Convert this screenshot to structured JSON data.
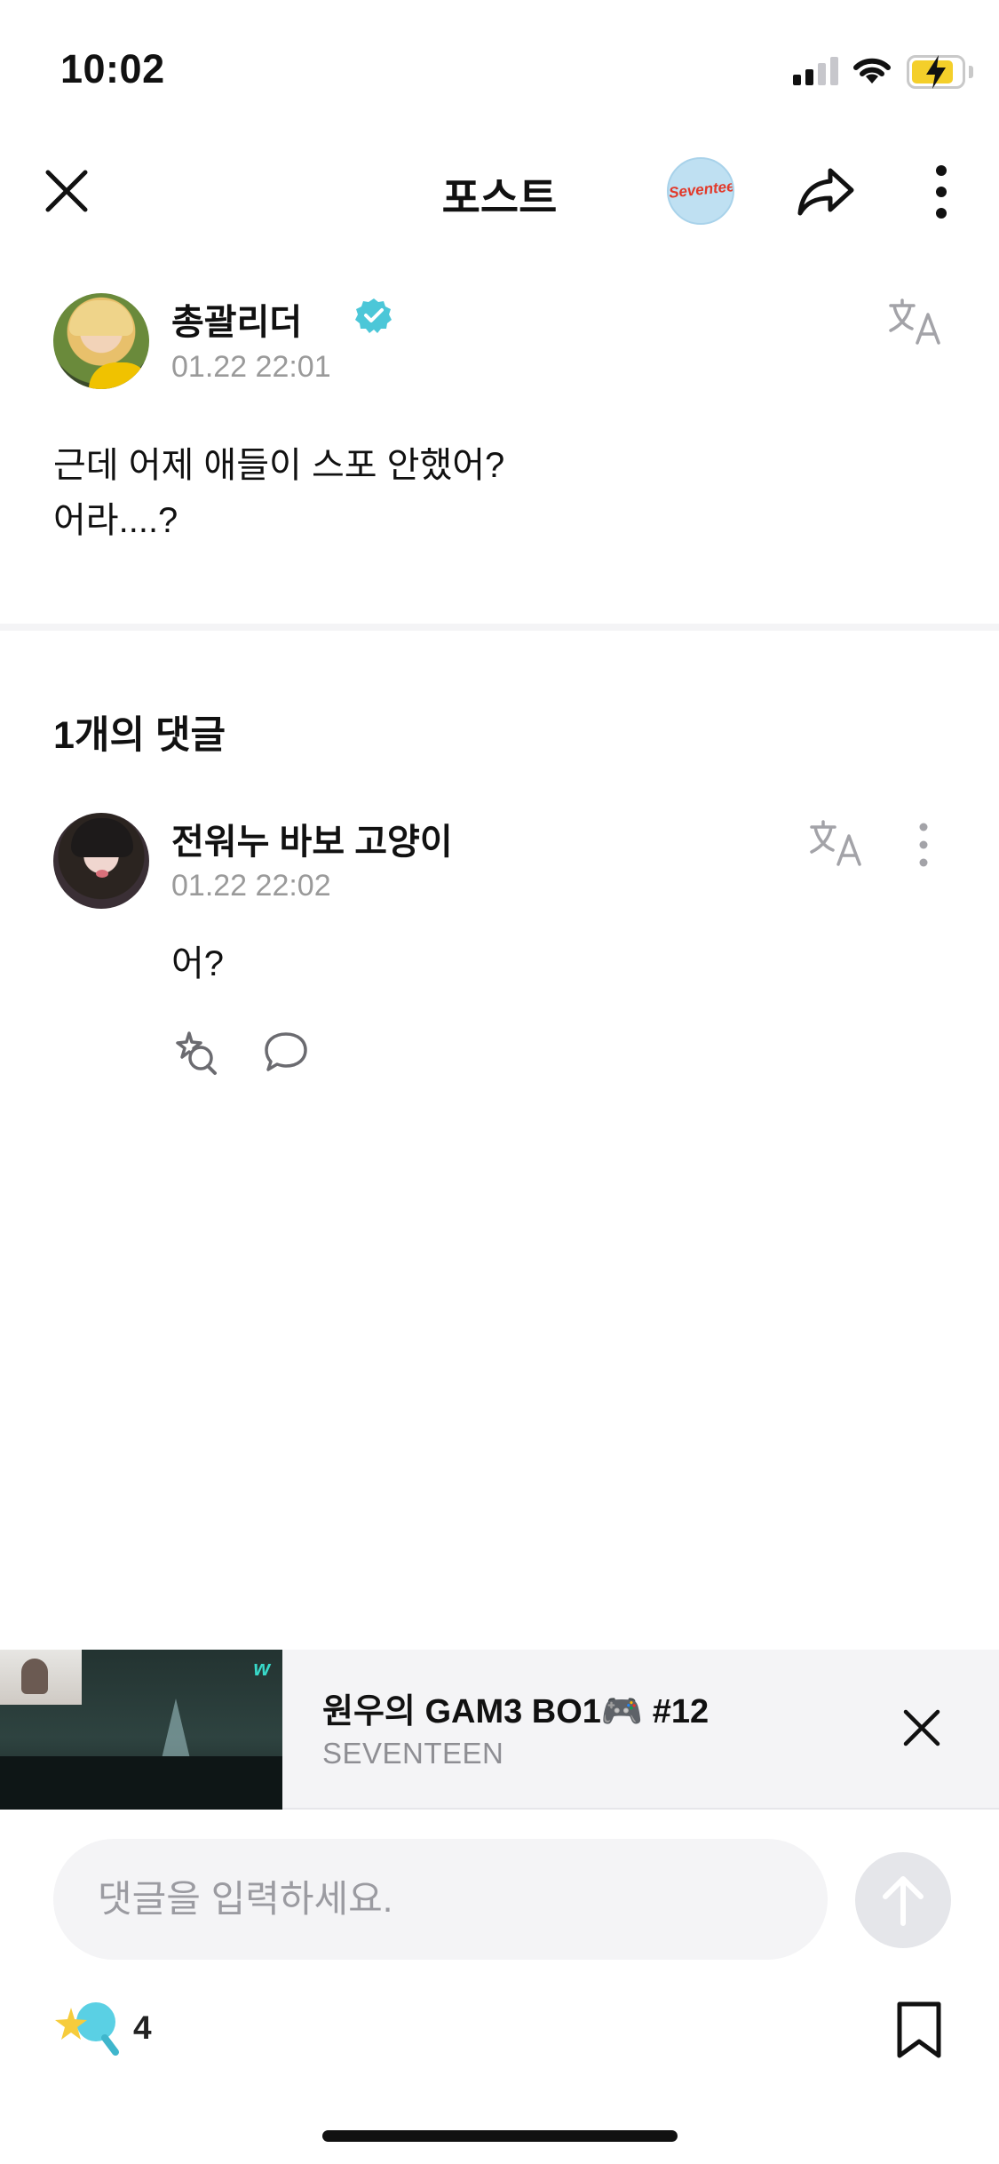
{
  "status_bar": {
    "time": "10:02"
  },
  "header": {
    "title": "포스트",
    "community_badge_text": "Seventeen",
    "icons": {
      "close": "close-icon",
      "share": "share-icon",
      "more": "more-vertical-icon"
    }
  },
  "post": {
    "author": "총괄리더",
    "verified": true,
    "timestamp": "01.22 22:01",
    "body": "근데 어제 애들이 스포 안했어?\n어라....?"
  },
  "comments_section": {
    "count_label": "1개의 댓글",
    "comments": [
      {
        "author": "전워누 바보 고양이",
        "timestamp": "01.22 22:02",
        "text": "어?"
      }
    ]
  },
  "mini_player": {
    "title": "원우의 GAM3 BO1🎮 #12",
    "channel": "SEVENTEEN",
    "thumb_logo": "w"
  },
  "comment_input": {
    "placeholder": "댓글을 입력하세요."
  },
  "bottom_bar": {
    "cheer_count": "4"
  },
  "colors": {
    "accent_verified": "#4cc7d8",
    "muted_text": "#9a9a9a",
    "input_bg": "#f4f4f6",
    "send_bg": "#e5e6ea",
    "battery": "#f4cf2a"
  }
}
